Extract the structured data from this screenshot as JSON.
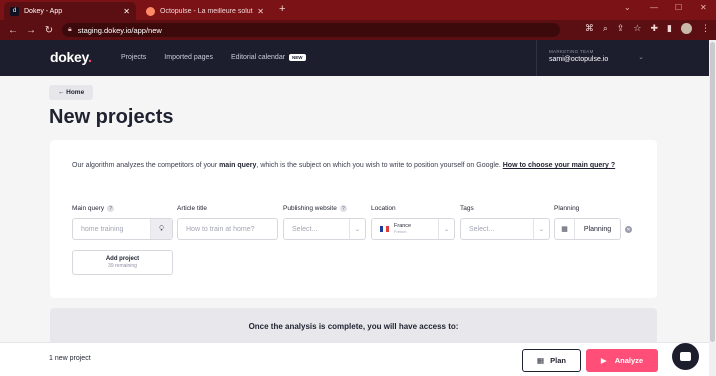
{
  "browser": {
    "tabs": [
      {
        "title": "Dokey - App",
        "favicon": "d"
      },
      {
        "title": "Octopulse - La meilleure solution",
        "favicon": "octopus-icon"
      }
    ],
    "url": "staging.dokey.io/app/new"
  },
  "header": {
    "logo": "dokey",
    "logo_dot": ".",
    "nav": [
      "Projects",
      "Imported pages",
      "Editorial calendar"
    ],
    "new_badge": "NEW",
    "account_team": "MARKETING TEAM",
    "account_email": "sami@octopulse.io"
  },
  "main": {
    "home_label": "Home",
    "title": "New projects",
    "intro_before": "Our algorithm analyzes the competitors of your ",
    "intro_bold": "main query",
    "intro_after": ", which is the subject on which you wish to write to position yourself on Google. ",
    "intro_link": "How to choose your main query ?",
    "fields": {
      "main_query_label": "Main query",
      "main_query_placeholder": "home training",
      "article_title_label": "Article title",
      "article_title_placeholder": "How to train at home?",
      "publishing_label": "Publishing website",
      "publishing_value": "Select...",
      "location_label": "Location",
      "location_country": "France",
      "location_language": "French",
      "tags_label": "Tags",
      "tags_value": "Select...",
      "planning_label": "Planning",
      "planning_value": "Planning"
    },
    "add_project": "Add project",
    "remaining": "39 remaining",
    "analysis_text": "Once the analysis is complete, you will have access to:"
  },
  "footer": {
    "count": "1 new project",
    "plan": "Plan",
    "analyze": "Analyze"
  },
  "colors": {
    "accent": "#ff4f79",
    "header": "#1c1e2e",
    "chrome": "#7a1216"
  }
}
